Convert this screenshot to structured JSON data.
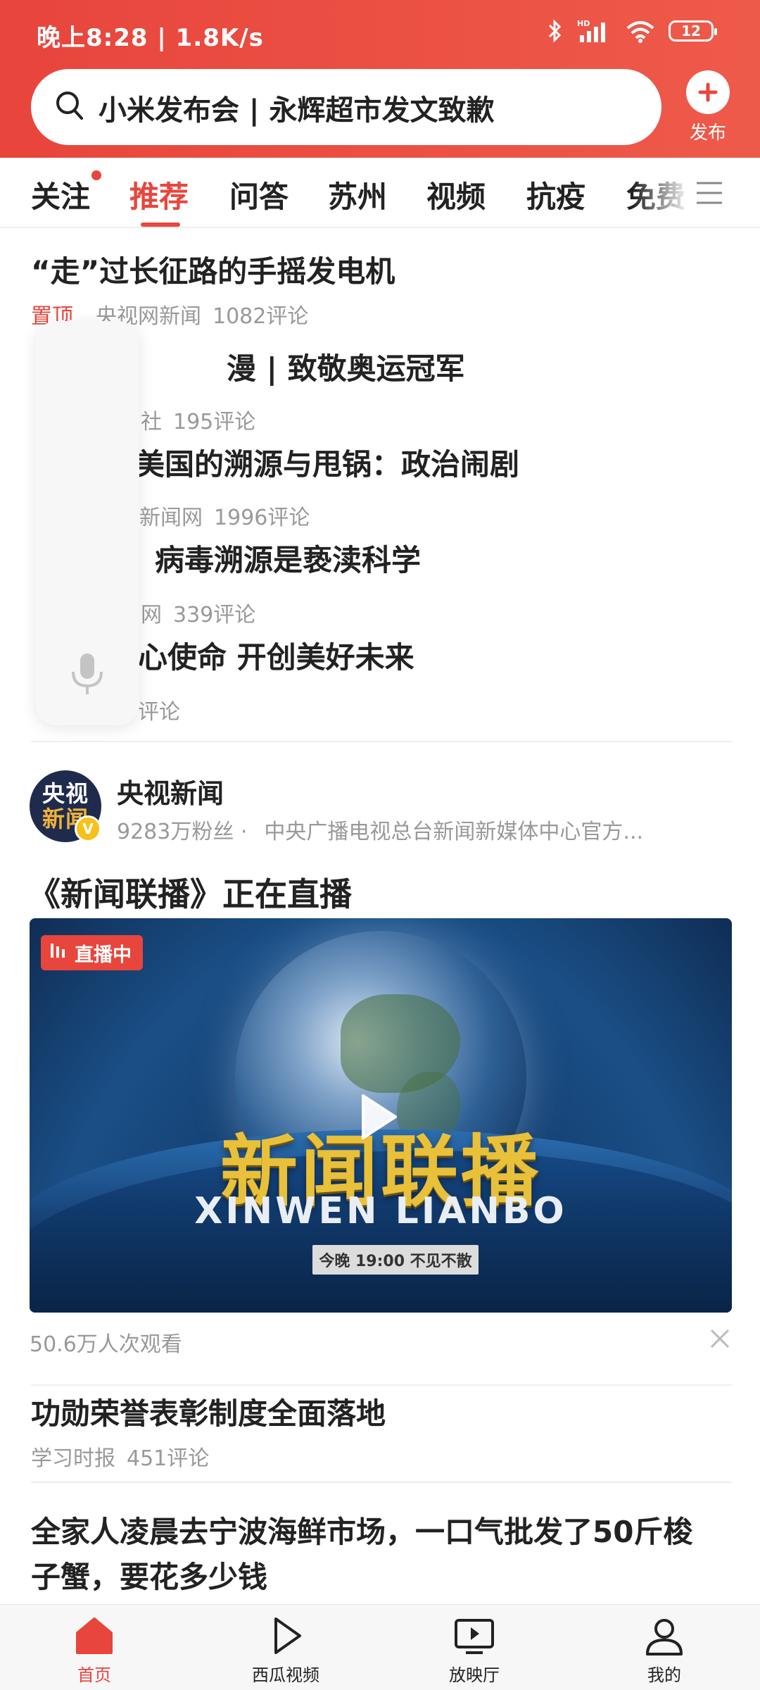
{
  "status_bar": {
    "time": "晚上8:28 | 1.8K/s",
    "battery": "12",
    "network": "HD"
  },
  "search": {
    "query": "小米发布会 | 永辉超市发文致歉"
  },
  "publish": {
    "label": "发布"
  },
  "tabs": [
    {
      "label": "关注",
      "dot": true
    },
    {
      "label": "推荐",
      "active": true
    },
    {
      "label": "问答"
    },
    {
      "label": "苏州"
    },
    {
      "label": "视频"
    },
    {
      "label": "抗疫"
    },
    {
      "label": "免费"
    }
  ],
  "news": [
    {
      "title": "“走”过长征路的手摇发电机",
      "pin": "置顶",
      "source": "央视网新闻",
      "comments": "1082评论"
    },
    {
      "title": "漫 | 致敬奥运冠军",
      "pin": "",
      "source": "社",
      "comments": "195评论"
    },
    {
      "title": "美国的溯源与甩锅：政治闹剧",
      "pin": "",
      "source": "新闻网",
      "comments": "1996评论"
    },
    {
      "title": "病毒溯源是亵渎科学",
      "pin": "",
      "source": "网",
      "comments": "339评论"
    },
    {
      "title": "心使命 开创美好未来",
      "pin": "",
      "source": "",
      "comments": "评论"
    }
  ],
  "account": {
    "avatar_line1": "央视",
    "avatar_line2": "新闻",
    "verified": "V",
    "name": "央视新闻",
    "followers": "9283万粉丝 ·",
    "desc": "中央广播电视总台新闻新媒体中心官方..."
  },
  "live": {
    "title": "《新闻联播》正在直播",
    "badge": "直播中",
    "video_title_cn": "新闻联播",
    "video_title_en": "XINWEN  LIANBO",
    "schedule": "今晚 19:00 不见不散",
    "views": "50.6万人次观看"
  },
  "news_after": [
    {
      "title": "功勋荣誉表彰制度全面落地",
      "source": "学习时报",
      "comments": "451评论"
    },
    {
      "title_line1": "全家人凌晨去宁波海鲜市场，一口气批发了50斤梭",
      "title_line2": "子蟹，要花多少钱"
    }
  ],
  "bottom_nav": [
    {
      "label": "首页",
      "icon": "home-icon",
      "active": true
    },
    {
      "label": "西瓜视频",
      "icon": "play-icon"
    },
    {
      "label": "放映厅",
      "icon": "tv-icon"
    },
    {
      "label": "我的",
      "icon": "user-icon"
    }
  ],
  "colors": {
    "brand": "#e8453c",
    "meta_text": "#999999",
    "title_text": "#222222"
  }
}
